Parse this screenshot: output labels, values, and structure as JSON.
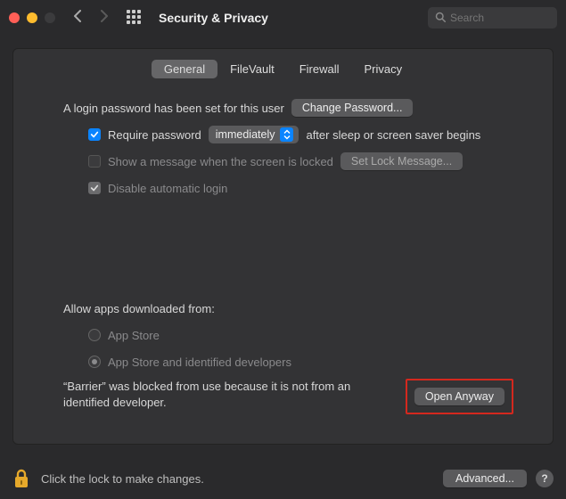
{
  "window": {
    "title": "Security & Privacy",
    "search_placeholder": "Search"
  },
  "tabs": [
    {
      "label": "General",
      "selected": true
    },
    {
      "label": "FileVault",
      "selected": false
    },
    {
      "label": "Firewall",
      "selected": false
    },
    {
      "label": "Privacy",
      "selected": false
    }
  ],
  "general": {
    "login_password_text": "A login password has been set for this user",
    "change_password_btn": "Change Password...",
    "require_password_label": "Require password",
    "require_password_delay": "immediately",
    "require_password_suffix": "after sleep or screen saver begins",
    "show_message_label": "Show a message when the screen is locked",
    "set_lock_message_btn": "Set Lock Message...",
    "disable_auto_login_label": "Disable automatic login",
    "allow_apps_header": "Allow apps downloaded from:",
    "radio_appstore": "App Store",
    "radio_appstore_dev": "App Store and identified developers",
    "blocked_message": "“Barrier” was blocked from use because it is not from an identified developer.",
    "open_anyway_btn": "Open Anyway"
  },
  "footer": {
    "lock_text": "Click the lock to make changes.",
    "advanced_btn": "Advanced...",
    "help": "?"
  }
}
